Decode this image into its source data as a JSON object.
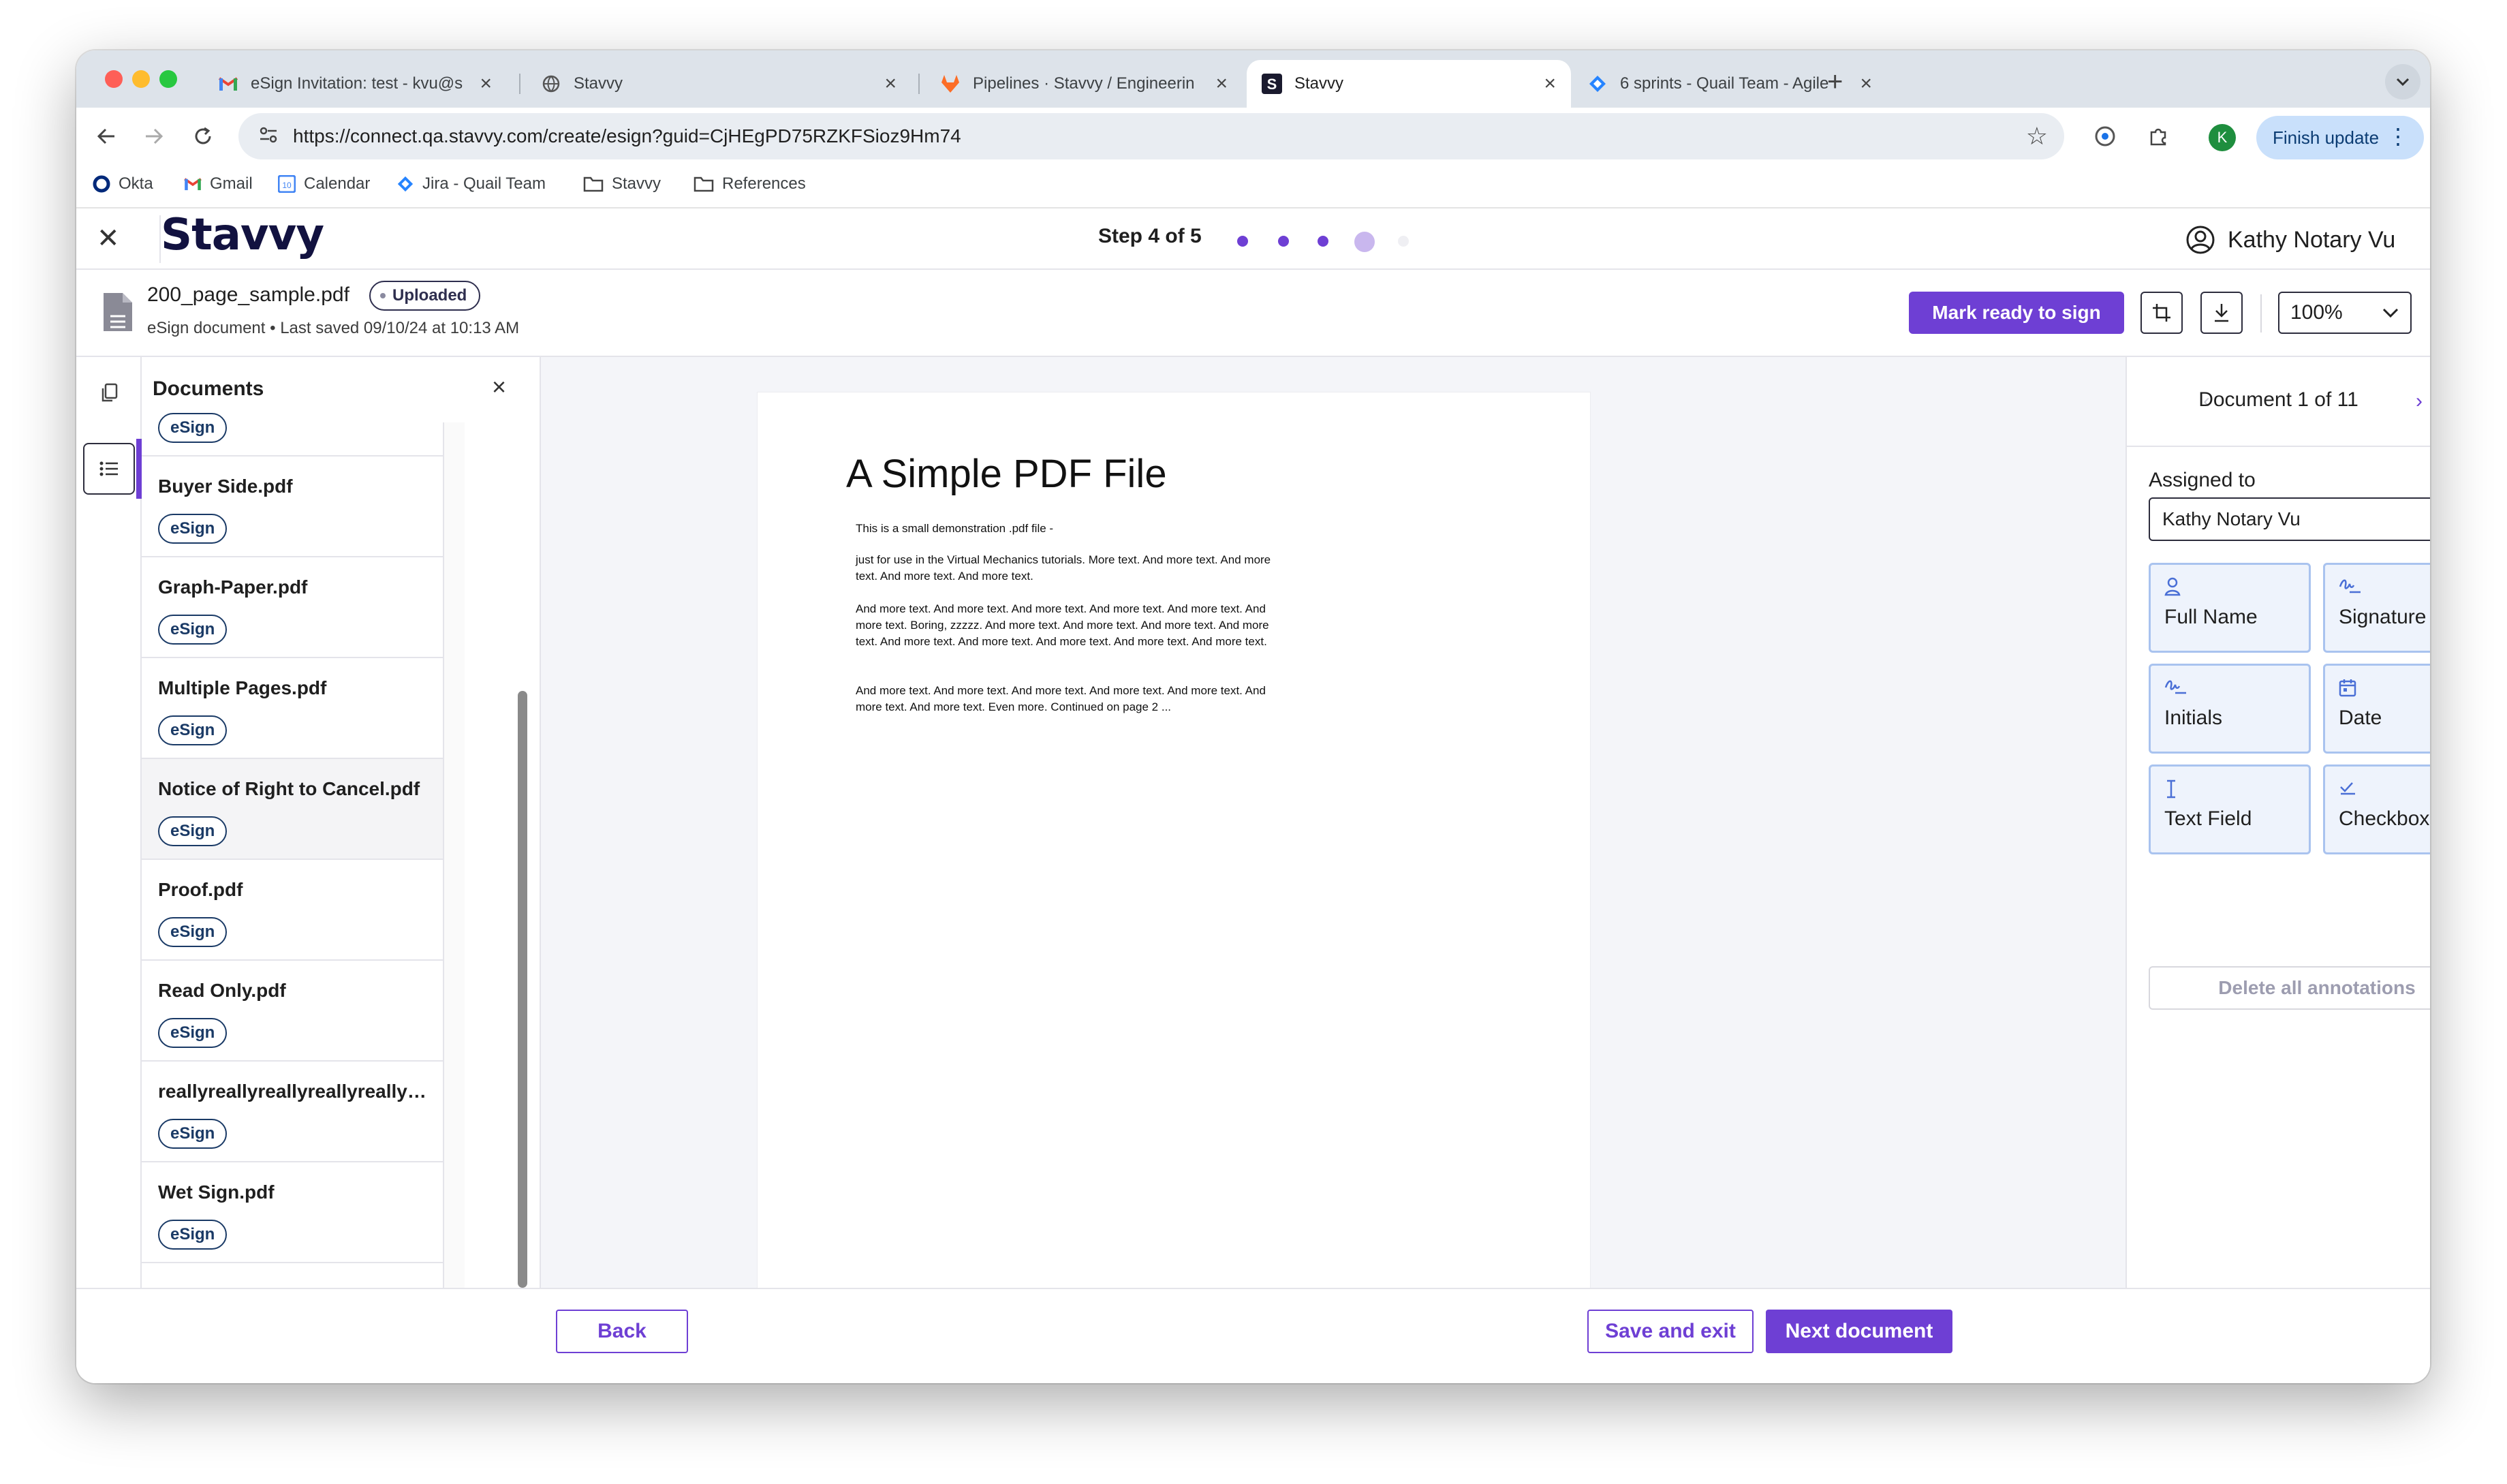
{
  "browser": {
    "tabs": [
      {
        "title": "eSign Invitation: test - kvu@s"
      },
      {
        "title": "Stavvy"
      },
      {
        "title": "Pipelines · Stavvy / Engineerin"
      },
      {
        "title": "Stavvy"
      },
      {
        "title": "6 sprints - Quail Team - Agile"
      }
    ],
    "url": "https://connect.qa.stavvy.com/create/esign?guid=CjHEgPD75RZKFSioz9Hm74",
    "profile_initial": "K",
    "finish_update": "Finish update",
    "bookmarks": [
      "Okta",
      "Gmail",
      "Calendar",
      "Jira - Quail Team",
      "Stavvy",
      "References"
    ]
  },
  "app": {
    "logo": "Stavvy",
    "step": "Step 4 of 5",
    "user_name": "Kathy Notary Vu",
    "accent_color": "#6e3fd4"
  },
  "docbar": {
    "file_name": "200_page_sample.pdf",
    "status_badge": "Uploaded",
    "subtitle": "eSign document • Last saved 09/10/24 at 10:13 AM",
    "mark_ready": "Mark ready to sign",
    "zoom": "100%"
  },
  "documents_panel": {
    "title": "Documents",
    "items": [
      {
        "name": "",
        "badge": "eSign"
      },
      {
        "name": "Buyer Side.pdf",
        "badge": "eSign"
      },
      {
        "name": "Graph-Paper.pdf",
        "badge": "eSign"
      },
      {
        "name": "Multiple Pages.pdf",
        "badge": "eSign"
      },
      {
        "name": "Notice of Right to Cancel.pdf",
        "badge": "eSign"
      },
      {
        "name": "Proof.pdf",
        "badge": "eSign"
      },
      {
        "name": "Read Only.pdf",
        "badge": "eSign"
      },
      {
        "name": "reallyreallyreallyreallyreallyreallyreallyreally.pdf",
        "badge": "eSign"
      },
      {
        "name": "Wet Sign.pdf",
        "badge": "eSign"
      }
    ]
  },
  "pdf": {
    "heading": "A Simple PDF File",
    "paragraphs": [
      "This is a small demonstration .pdf file -",
      "just for use in the Virtual Mechanics tutorials. More text. And more text. And more text. And more text. And more text.",
      "And more text. And more text. And more text. And more text. And more text. And more text. Boring, zzzzz. And more text. And more text. And more text. And more text. And more text. And more text. And more text. And more text. And more text.",
      "And more text. And more text. And more text. And more text. And more text. And more text. And more text. Even more. Continued on page 2 ..."
    ]
  },
  "right_panel": {
    "doc_counter": "Document 1 of 11",
    "assigned_label": "Assigned to",
    "assignee": "Kathy Notary Vu",
    "fields": [
      {
        "label": "Full Name",
        "icon": "person-icon"
      },
      {
        "label": "Signature",
        "icon": "signature-icon"
      },
      {
        "label": "Initials",
        "icon": "initials-icon"
      },
      {
        "label": "Date",
        "icon": "calendar-icon"
      },
      {
        "label": "Text Field",
        "icon": "text-cursor-icon"
      },
      {
        "label": "Checkbox",
        "icon": "check-icon"
      }
    ],
    "delete_all": "Delete all annotations"
  },
  "footer": {
    "back": "Back",
    "save_exit": "Save and exit",
    "next": "Next document"
  }
}
